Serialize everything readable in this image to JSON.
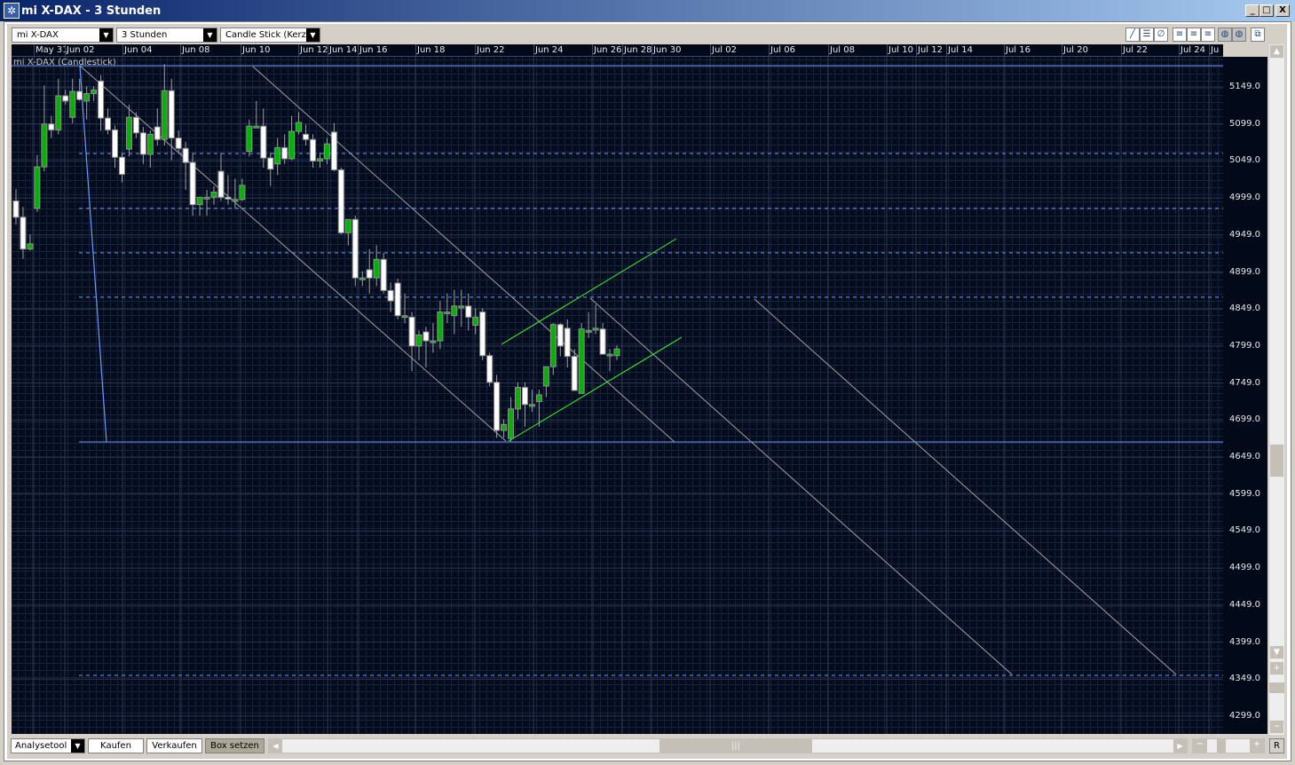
{
  "window": {
    "title": "mi X-DAX - 3 Stunden",
    "minimize": "_",
    "maximize": "□",
    "close": "X"
  },
  "toolbar": {
    "instrument": "mi X-DAX",
    "interval": "3 Stunden",
    "chart_type": "Candle Stick (Kerze"
  },
  "chart": {
    "series_label": "mi X-DAX (Candlestick)",
    "dates": [
      "May 31",
      "Jun 02",
      "Jun 04",
      "Jun 08",
      "Jun 10",
      "Jun 12",
      "Jun 14",
      "Jun 16",
      "Jun 18",
      "Jun 22",
      "Jun 24",
      "Jun 26",
      "Jun 28",
      "Jun 30",
      "Jul 02",
      "Jul 06",
      "Jul 08",
      "Jul 10",
      "Jul 12",
      "Jul 14",
      "Jul 16",
      "Jul 20",
      "Jul 22",
      "Jul 24",
      "Ju"
    ],
    "prices": [
      "5149.0",
      "5099.0",
      "5049.0",
      "4999.0",
      "4949.0",
      "4899.0",
      "4849.0",
      "4799.0",
      "4749.0",
      "4699.0",
      "4649.0",
      "4599.0",
      "4549.0",
      "4499.0",
      "4449.0",
      "4399.0",
      "4349.0",
      "4299.0"
    ],
    "colors": {
      "up": "#00b400",
      "down": "#ffffff",
      "wick": "#a0a0a0",
      "trend": "#6a9bff",
      "channel": "#33ff33",
      "line": "#a0a0a0"
    }
  },
  "chart_data": {
    "type": "candlestick",
    "title": "mi X-DAX (Candlestick)",
    "ylim": [
      4270,
      5180
    ],
    "horizontal_levels": [
      5059,
      4985,
      4925,
      4865,
      4354
    ],
    "support": 4670,
    "resistance": 5178,
    "ohlc": [
      [
        4995,
        5011,
        4963,
        4973
      ],
      [
        4973,
        4987,
        4917,
        4930
      ],
      [
        4930,
        4950,
        4928,
        4937
      ],
      [
        4985,
        5057,
        4980,
        5041
      ],
      [
        5041,
        5151,
        5035,
        5099
      ],
      [
        5099,
        5110,
        5080,
        5091
      ],
      [
        5091,
        5160,
        5085,
        5137
      ],
      [
        5137,
        5145,
        5125,
        5130
      ],
      [
        5108,
        5160,
        5100,
        5143
      ],
      [
        5143,
        5160,
        5130,
        5132
      ],
      [
        5130,
        5150,
        5105,
        5140
      ],
      [
        5140,
        5150,
        5130,
        5145
      ],
      [
        5157,
        5165,
        5090,
        5107
      ],
      [
        5107,
        5120,
        5085,
        5091
      ],
      [
        5091,
        5097,
        5040,
        5054
      ],
      [
        5054,
        5060,
        5020,
        5031
      ],
      [
        5065,
        5125,
        5055,
        5108
      ],
      [
        5108,
        5115,
        5080,
        5087
      ],
      [
        5087,
        5095,
        5045,
        5058
      ],
      [
        5058,
        5090,
        5040,
        5085
      ],
      [
        5095,
        5120,
        5070,
        5078
      ],
      [
        5078,
        5180,
        5070,
        5144
      ],
      [
        5144,
        5160,
        5050,
        5080
      ],
      [
        5080,
        5090,
        5060,
        5066
      ],
      [
        5066,
        5075,
        5010,
        5047
      ],
      [
        5047,
        5060,
        4975,
        4990
      ],
      [
        4990,
        5000,
        4975,
        5000
      ],
      [
        4999,
        5010,
        4975,
        5000
      ],
      [
        5000,
        5015,
        4990,
        5007
      ],
      [
        5035,
        5060,
        4995,
        5000
      ],
      [
        5000,
        5030,
        4990,
        4998
      ],
      [
        4997,
        5025,
        4985,
        4997
      ],
      [
        4997,
        5025,
        4995,
        5016
      ],
      [
        5062,
        5105,
        5055,
        5096
      ],
      [
        5096,
        5130,
        5096,
        5096
      ],
      [
        5096,
        5120,
        5040,
        5053
      ],
      [
        5053,
        5060,
        5015,
        5038
      ],
      [
        5045,
        5080,
        5030,
        5067
      ],
      [
        5067,
        5085,
        5045,
        5052
      ],
      [
        5052,
        5110,
        5050,
        5089
      ],
      [
        5089,
        5115,
        5085,
        5101
      ],
      [
        5085,
        5098,
        5070,
        5078
      ],
      [
        5078,
        5085,
        5040,
        5049
      ],
      [
        5049,
        5060,
        5040,
        5052
      ],
      [
        5052,
        5080,
        5045,
        5072
      ],
      [
        5088,
        5100,
        5035,
        5037
      ],
      [
        5037,
        5040,
        4950,
        4952
      ],
      [
        4952,
        4965,
        4935,
        4970
      ],
      [
        4970,
        4975,
        4880,
        4891
      ],
      [
        4891,
        4900,
        4880,
        4891
      ],
      [
        4902,
        4930,
        4870,
        4891
      ],
      [
        4891,
        4935,
        4880,
        4916
      ],
      [
        4916,
        4925,
        4870,
        4874
      ],
      [
        4874,
        4885,
        4845,
        4860
      ],
      [
        4884,
        4890,
        4835,
        4840
      ],
      [
        4840,
        4870,
        4830,
        4840
      ],
      [
        4838,
        4845,
        4765,
        4799
      ],
      [
        4799,
        4820,
        4780,
        4814
      ],
      [
        4818,
        4825,
        4770,
        4806
      ],
      [
        4806,
        4830,
        4790,
        4806
      ],
      [
        4806,
        4860,
        4795,
        4845
      ],
      [
        4845,
        4870,
        4830,
        4845
      ],
      [
        4840,
        4875,
        4815,
        4853
      ],
      [
        4853,
        4875,
        4825,
        4853
      ],
      [
        4853,
        4870,
        4820,
        4838
      ],
      [
        4827,
        4850,
        4815,
        4838
      ],
      [
        4845,
        4850,
        4780,
        4786
      ],
      [
        4786,
        4790,
        4745,
        4750
      ],
      [
        4750,
        4760,
        4675,
        4685
      ],
      [
        4685,
        4700,
        4675,
        4693
      ],
      [
        4674,
        4730,
        4670,
        4714
      ],
      [
        4714,
        4750,
        4700,
        4743
      ],
      [
        4743,
        4750,
        4690,
        4720
      ],
      [
        4720,
        4740,
        4710,
        4720
      ],
      [
        4724,
        4740,
        4690,
        4733
      ],
      [
        4745,
        4770,
        4730,
        4771
      ],
      [
        4771,
        4830,
        4760,
        4828
      ],
      [
        4828,
        4830,
        4785,
        4799
      ],
      [
        4823,
        4835,
        4770,
        4785
      ],
      [
        4785,
        4795,
        4740,
        4739
      ],
      [
        4735,
        4830,
        4735,
        4822
      ],
      [
        4820,
        4845,
        4810,
        4820
      ],
      [
        4823,
        4855,
        4815,
        4823
      ],
      [
        4822,
        4830,
        4790,
        4788
      ],
      [
        4788,
        4795,
        4765,
        4788
      ],
      [
        4786,
        4800,
        4780,
        4795
      ]
    ]
  },
  "bottom": {
    "analysis_tool": "Analysetool",
    "buy": "Kaufen",
    "sell": "Verkaufen",
    "set_box": "Box setzen",
    "reset": "R",
    "plus": "+",
    "minus": "−"
  }
}
